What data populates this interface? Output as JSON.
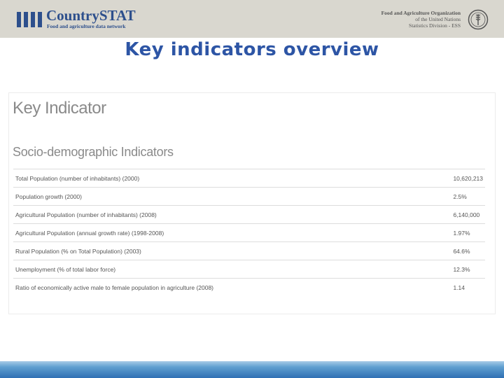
{
  "header": {
    "logo_title": "CountrySTAT",
    "logo_subtitle": "Food and agriculture data network",
    "org_lines": [
      "Food and Agriculture Organization",
      "of the United Nations",
      "Statistics Division - ESS"
    ],
    "brand_color": "#2d4f8c"
  },
  "slide": {
    "title": "Key indicators overview",
    "title_color": "#2d55a5"
  },
  "panel": {
    "heading": "Key Indicator",
    "section": "Socio-demographic Indicators",
    "rows": [
      {
        "label": "Total Population (number of inhabitants) (2000)",
        "value": "10,620,213"
      },
      {
        "label": "Population growth (2000)",
        "value": "2.5%"
      },
      {
        "label": "Agricultural Population (number of inhabitants) (2008)",
        "value": "6,140,000"
      },
      {
        "label": "Agricultural Population (annual growth rate) (1998-2008)",
        "value": "1.97%"
      },
      {
        "label": "Rural Population (% on Total Population) (2003)",
        "value": "64.6%"
      },
      {
        "label": "Unemployment (% of total labor force)",
        "value": "12.3%"
      },
      {
        "label": "Ratio of economically active male to female population in agriculture (2008)",
        "value": "1.14"
      }
    ]
  }
}
